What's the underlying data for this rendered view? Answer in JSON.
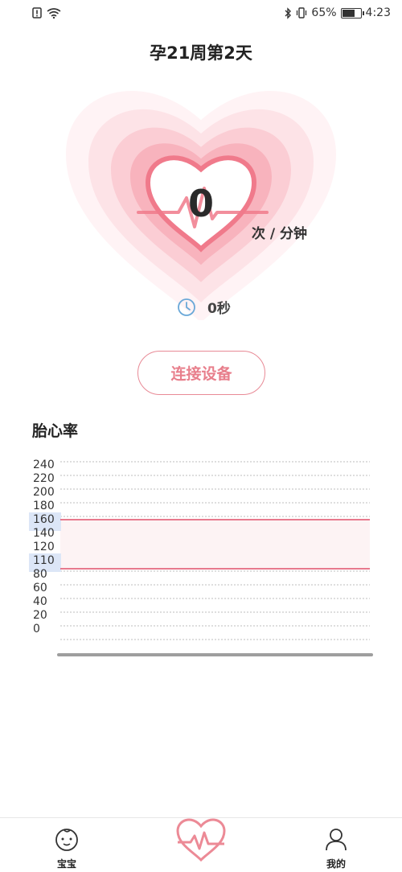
{
  "status_bar": {
    "battery_percent": "65%",
    "time": "4:23",
    "battery_level": 0.65,
    "icons": [
      "alert-icon",
      "wifi-icon",
      "bluetooth-icon",
      "vibrate-icon",
      "battery-icon"
    ]
  },
  "header": {
    "title": "孕21周第2天"
  },
  "monitor": {
    "bpm": "0",
    "unit": "次 / 分钟",
    "duration": "0秒"
  },
  "connect_button": {
    "label": "连接设备"
  },
  "fetal_heart_rate": {
    "section_title": "胎心率"
  },
  "chart_data": {
    "type": "line",
    "y_ticks": [
      "240",
      "220",
      "200",
      "180",
      "160",
      "140",
      "120",
      "110",
      "80",
      "60",
      "40",
      "20",
      "0"
    ],
    "highlighted_ticks": [
      "160",
      "110"
    ],
    "ylim": [
      0,
      240
    ],
    "normal_range": [
      110,
      160
    ],
    "series": [],
    "grid": true,
    "colors": {
      "range_line": "#e0506a",
      "grid": "#bdbdbd",
      "highlight": "#dce6f7"
    }
  },
  "bottom_nav": {
    "items": [
      {
        "label": "宝宝",
        "icon": "baby-face-icon"
      },
      {
        "label": "",
        "icon": "heartbeat-icon"
      },
      {
        "label": "我的",
        "icon": "person-icon"
      }
    ]
  },
  "colors": {
    "accent": "#e87f8c",
    "heart_light": "#fde4e8",
    "heart_mid": "#f9b9c2"
  }
}
